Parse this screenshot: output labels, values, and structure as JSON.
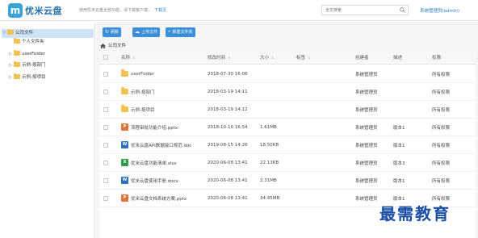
{
  "header": {
    "logo_char": "m",
    "brand": "优米云盘",
    "notice": "使用优米云盘全部功能，请下载客户端，",
    "download_link": "下载页",
    "search_placeholder": "全文搜索",
    "user": "系统管理员(admin)"
  },
  "sidebar": {
    "root": {
      "arrow": "▽",
      "label": "公司文件"
    },
    "items": [
      {
        "arrow": "",
        "label": "个人文件夹"
      },
      {
        "arrow": "▷",
        "label": "userFolder"
      },
      {
        "arrow": "▷",
        "label": "示例-按部门"
      },
      {
        "arrow": "▷",
        "label": "示例-按项目"
      }
    ]
  },
  "toolbar": {
    "refresh": "刷新",
    "upload": "上传文件",
    "new_folder": "新建文件夹"
  },
  "breadcrumb": {
    "label": "公司文件"
  },
  "table": {
    "headers": {
      "name": "名称",
      "time": "修改时间",
      "size": "大小",
      "tag": "标签",
      "creator": "创建者",
      "version": "描述",
      "permission": "权限"
    },
    "rows": [
      {
        "type": "folder",
        "icon_text": "",
        "name": "userFolder",
        "time": "2018-07-30 16:06",
        "size": "",
        "tag": "",
        "creator": "系统管理员",
        "version": "",
        "permission": "所有权限"
      },
      {
        "type": "folder",
        "icon_text": "",
        "name": "示例-按部门",
        "time": "2018-03-19 14:11",
        "size": "",
        "tag": "",
        "creator": "系统管理员",
        "version": "",
        "permission": "所有权限"
      },
      {
        "type": "folder",
        "icon_text": "",
        "name": "示例-按项目",
        "time": "2018-03-19 14:12",
        "size": "",
        "tag": "",
        "creator": "系统管理员",
        "version": "",
        "permission": "所有权限"
      },
      {
        "type": "pptx",
        "icon_text": "P",
        "name": "流程审批功能介绍.pptx",
        "time": "2018-10-10 16:54",
        "size": "1.61MB",
        "tag": "",
        "creator": "系统管理员",
        "version": "版本1",
        "permission": "所有权限"
      },
      {
        "type": "docx",
        "icon_text": "W",
        "name": "优米云盘API数据接口规范.doc",
        "time": "2019-08-15 14:26",
        "size": "18.50KB",
        "tag": "",
        "creator": "系统管理员",
        "version": "版本1",
        "permission": "所有权限"
      },
      {
        "type": "xlsx",
        "icon_text": "X",
        "name": "优米云盘功能清单.xlsx",
        "time": "2020-06-08 13:41",
        "size": "22.13KB",
        "tag": "",
        "creator": "系统管理员",
        "version": "版本3",
        "permission": "所有权限"
      },
      {
        "type": "docx",
        "icon_text": "W",
        "name": "优米云盘使用手册.docx",
        "time": "2020-06-08 13:41",
        "size": "2.31MB",
        "tag": "",
        "creator": "系统管理员",
        "version": "版本1",
        "permission": "所有权限"
      },
      {
        "type": "pptx",
        "icon_text": "P",
        "name": "优米云盘文档系统方案.pptx",
        "time": "2020-06-08 13:41",
        "size": "34.45MB",
        "tag": "",
        "creator": "系统管理员",
        "version": "版本1",
        "permission": "所有权限"
      }
    ]
  },
  "watermark": "最需教育",
  "colors": {
    "accent": "#3a8fd8",
    "brand": "#1f6fa8",
    "folder": "#f3c250",
    "pptx": "#e5733a",
    "docx": "#2b6fc0",
    "xlsx": "#2f9a4b",
    "selected_bg": "#cfe4f6"
  }
}
